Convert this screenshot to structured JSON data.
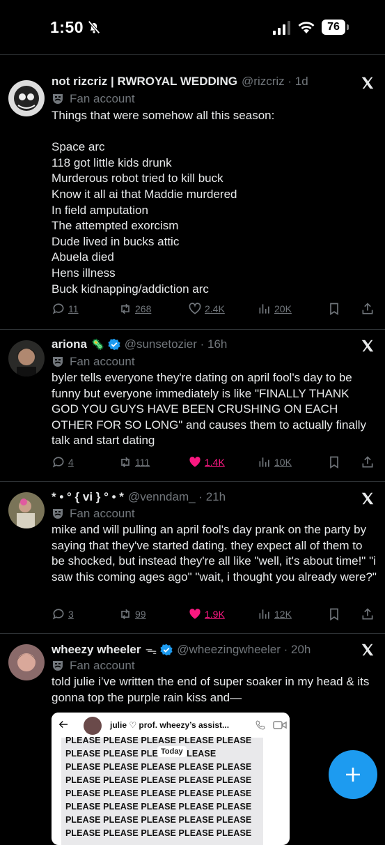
{
  "status_bar": {
    "time": "1:50",
    "battery": "76"
  },
  "tweets": [
    {
      "name": "not rizcriz | RWROYAL WEDDING",
      "handle": "@rizcriz · 1d",
      "badge": "Fan account",
      "text": "Things that were somehow all this season:\n\nSpace arc\n118 got little kids drunk\nMurderous robot tried to kill buck\nKnow it all ai that Maddie murdered\nIn field amputation\nThe attempted exorcism\nDude lived in bucks attic\nAbuela died\nHens illness\nBuck kidnapping/addiction arc",
      "replies": "11",
      "reposts": "268",
      "likes": "2.4K",
      "views": "20K",
      "liked": false
    },
    {
      "name": "ariona",
      "name_emoji": "🦠",
      "verified": true,
      "handle": "@sunsetozier · 16h",
      "badge": "Fan account",
      "text": "byler tells everyone they're dating on april fool's day to be funny but everyone immediately is like \"FINALLY THANK GOD YOU GUYS HAVE BEEN CRUSHING ON EACH OTHER FOR SO LONG\" and causes them to actually finally talk and start dating",
      "replies": "4",
      "reposts": "111",
      "likes": "1.4K",
      "views": "10K",
      "liked": true
    },
    {
      "name": "* • ° { vi } ° • *",
      "handle": "@venndam_ · 21h",
      "badge": "Fan account",
      "text": "mike and will pulling an april fool's day prank on the party by saying that they've started dating. they expect all of them to be shocked, but instead they're all like \"well, it's about time!\" \"i saw this coming ages ago\" \"wait, i thought you already were?\"",
      "replies": "3",
      "reposts": "99",
      "likes": "1.9K",
      "views": "12K",
      "liked": true
    },
    {
      "name": "wheezy wheeler",
      "name_emoji": "ᯓ",
      "verified": true,
      "handle": "@wheezingwheeler · 20h",
      "badge": "Fan account",
      "text": "told julie i’ve written the end of super soaker in my head & its gonna top the purple rain kiss and—"
    }
  ],
  "embed": {
    "title": "julie ♡ prof. wheezy’s assist...",
    "lines": [
      "PLEASE PLEASE PLEASE PLEASE PLEASE",
      "PLEASE PLEASE PLE           ASE PLEASE",
      "PLEASE PLEASE PLEASE PLEASE PLEASE",
      "PLEASE PLEASE PLEASE PLEASE PLEASE",
      "PLEASE PLEASE PLEASE PLEASE PLEASE",
      "PLEASE PLEASE PLEASE PLEASE PLEASE",
      "PLEASE PLEASE PLEASE PLEASE PLEASE",
      "PLEASE PLEASE PLEASE PLEASE PLEASE"
    ],
    "today": "Today"
  },
  "colors": {
    "accent": "#1d9bf0",
    "like": "#f91880",
    "muted": "#71767b"
  }
}
